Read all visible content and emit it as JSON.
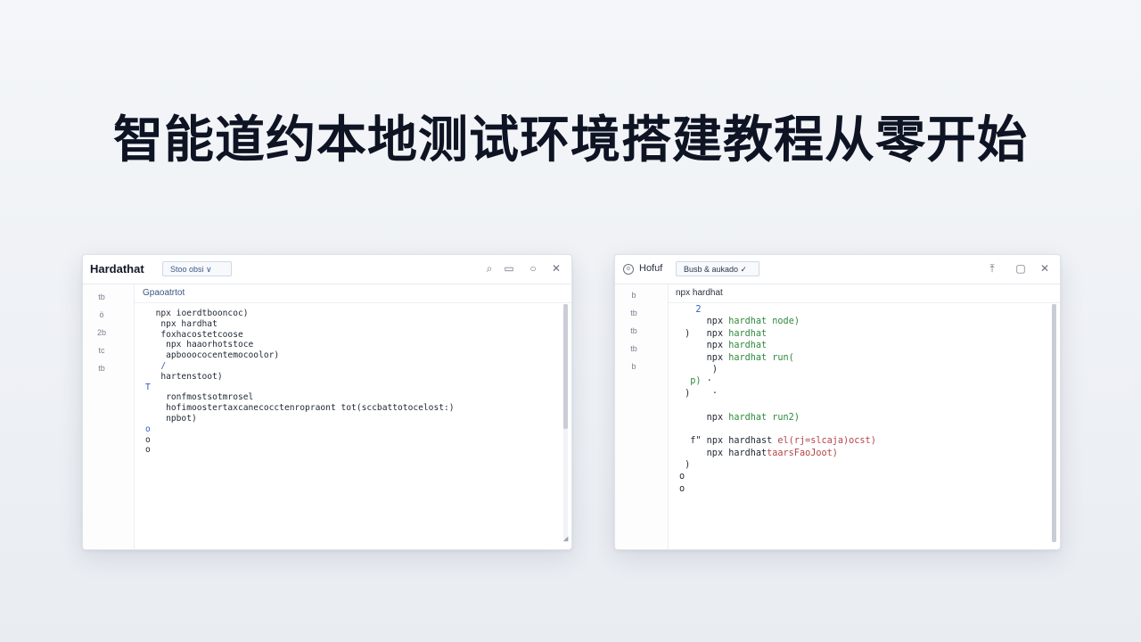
{
  "headline": "智能道约本地测试环境搭建教程从零开始",
  "left_window": {
    "title": "Hardathat",
    "dropdown": "Stoo obsi ∨",
    "controls": {
      "search": "⌕",
      "minimize": "▭",
      "maximize": "○",
      "close": "✕"
    },
    "gutter_icons": [
      "tb",
      "ö",
      "2b",
      "tc",
      "tb"
    ],
    "tab_label": "Gpaoatrtot",
    "code_lines": [
      {
        "indent": "  ",
        "text": "npx ioerdtbooncoc)"
      },
      {
        "indent": "   ",
        "text": "npx hardhat"
      },
      {
        "indent": "   ",
        "text": "foxhacostetcoose"
      },
      {
        "indent": "    ",
        "text": "npx haaorhotstoce"
      },
      {
        "indent": "    ",
        "text": "apbooococentemocoolor)"
      },
      {
        "indent": "   ",
        "text": "/",
        "cls": "blue"
      },
      {
        "indent": "   ",
        "text": "hartenstoot)"
      },
      {
        "indent": "",
        "text": "T",
        "cls": "blue"
      },
      {
        "indent": "    ",
        "text": "ronfmostsotmrosel"
      },
      {
        "indent": "    ",
        "text": "hofimoostertaxcanecocctenropraont tot(sccbattotocelost:)"
      },
      {
        "indent": "    ",
        "text": "npbot)"
      },
      {
        "indent": "",
        "text": "o",
        "cls": "blue"
      },
      {
        "indent": "",
        "text": "o"
      },
      {
        "indent": "",
        "text": "o"
      }
    ]
  },
  "right_window": {
    "badge": "o",
    "title": "Hofuf",
    "dropdown": "Busb & aukado ✓",
    "controls": {
      "upload": "⤒",
      "comment": "▢",
      "close": "✕"
    },
    "gutter_icons": [
      "b",
      "tb",
      "tb",
      "tb",
      "b"
    ],
    "tab_label": "npx hardhat",
    "code_lines": [
      {
        "parts": [
          {
            "t": "2",
            "cls": "blue"
          }
        ],
        "indent": "   "
      },
      {
        "indent": "     ",
        "parts": [
          {
            "t": "npx "
          },
          {
            "t": "hardhat",
            "cls": "green"
          },
          {
            "t": " node)",
            "cls": "green"
          }
        ]
      },
      {
        "indent": " )   ",
        "parts": [
          {
            "t": "npx "
          },
          {
            "t": "hardhat",
            "cls": "green"
          }
        ]
      },
      {
        "indent": "     ",
        "parts": [
          {
            "t": "npx "
          },
          {
            "t": "hardhat",
            "cls": "green"
          }
        ]
      },
      {
        "indent": "     ",
        "parts": [
          {
            "t": "npx "
          },
          {
            "t": "hardhat run(",
            "cls": "green"
          }
        ]
      },
      {
        "indent": "      ",
        "parts": [
          {
            "t": ")"
          }
        ]
      },
      {
        "indent": "  ",
        "parts": [
          {
            "t": "p)",
            "cls": "green"
          },
          {
            "t": " ·"
          }
        ]
      },
      {
        "indent": " )    ",
        "parts": [
          {
            "t": "·"
          }
        ]
      },
      {
        "indent": "",
        "parts": [
          {
            "t": ""
          }
        ]
      },
      {
        "indent": "     ",
        "parts": [
          {
            "t": "npx "
          },
          {
            "t": "hardhat run2)",
            "cls": "green"
          }
        ]
      },
      {
        "indent": "",
        "parts": [
          {
            "t": ""
          }
        ]
      },
      {
        "indent": "  ",
        "parts": [
          {
            "t": "f\" npx hardhast "
          },
          {
            "t": "el(rj=slcaja)ocst)",
            "cls": "multi"
          }
        ]
      },
      {
        "indent": "     ",
        "parts": [
          {
            "t": "npx hardhat"
          },
          {
            "t": "taarsFaoJoot)",
            "cls": "multi"
          }
        ]
      },
      {
        "indent": " ",
        "parts": [
          {
            "t": ")"
          }
        ]
      },
      {
        "indent": "",
        "parts": [
          {
            "t": "o"
          }
        ]
      },
      {
        "indent": "",
        "parts": [
          {
            "t": "o"
          }
        ]
      }
    ]
  }
}
